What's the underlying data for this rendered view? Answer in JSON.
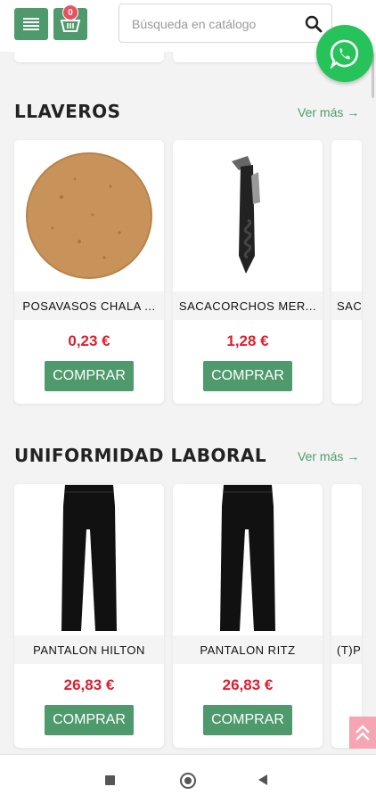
{
  "header": {
    "cart_count": "0",
    "search_placeholder": "Búsqueda en catálogo"
  },
  "sections": [
    {
      "title": "LLAVEROS",
      "see_more": "Ver más →",
      "products": [
        {
          "name": "POSAVASOS CHALA ...",
          "price": "0,23 €",
          "buy": "COMPRAR"
        },
        {
          "name": "SACACORCHOS MER...",
          "price": "1,28 €",
          "buy": "COMPRAR"
        },
        {
          "name": "SAC"
        }
      ]
    },
    {
      "title": "UNIFORMIDAD LABORAL",
      "see_more": "Ver más →",
      "products": [
        {
          "name": "PANTALON HILTON",
          "price": "26,83 €",
          "buy": "COMPRAR"
        },
        {
          "name": "PANTALON RITZ",
          "price": "26,83 €",
          "buy": "COMPRAR"
        },
        {
          "name": "(T)P"
        }
      ]
    }
  ],
  "colors": {
    "accent": "#4e9a6c",
    "price": "#e01d2e",
    "whatsapp": "#25c35a",
    "badge": "#e8515f"
  },
  "icons": [
    "menu-icon",
    "cart-icon",
    "search-icon",
    "whatsapp-icon",
    "chevron-up-icon"
  ]
}
